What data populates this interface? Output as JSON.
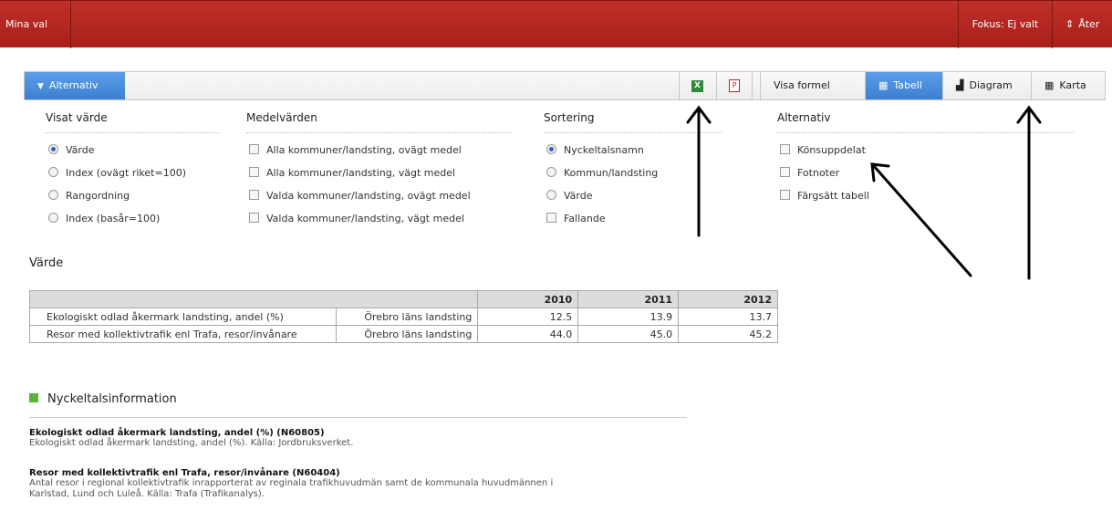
{
  "topbar": {
    "left_label": "Mina val",
    "focus_label": "Fokus: Ej valt",
    "back_label": "Åter"
  },
  "toolbar": {
    "alternativ_label": "Alternativ",
    "tabs": [
      "Visa formel",
      "Tabell",
      "Diagram",
      "Karta"
    ],
    "active_tab": "Tabell"
  },
  "options": {
    "visat_varde": {
      "title": "Visat värde",
      "items": [
        "Värde",
        "Index (ovägt riket=100)",
        "Rangordning",
        "Index (basår=100)"
      ],
      "selected": "Värde"
    },
    "medelvarden": {
      "title": "Medelvärden",
      "items": [
        "Alla kommuner/landsting, ovägt medel",
        "Alla kommuner/landsting, vägt medel",
        "Valda kommuner/landsting, ovägt medel",
        "Valda kommuner/landsting, vägt medel"
      ]
    },
    "sortering": {
      "title": "Sortering",
      "radio_items": [
        "Nyckeltalsnamn",
        "Kommun/landsting",
        "Värde"
      ],
      "selected": "Nyckeltalsnamn",
      "check_item": "Fallande"
    },
    "alternativ": {
      "title": "Alternativ",
      "items": [
        "Könsuppdelat",
        "Fotnoter",
        "Färgsätt tabell"
      ]
    }
  },
  "section_title": "Värde",
  "table": {
    "years": [
      "2010",
      "2011",
      "2012"
    ],
    "rows": [
      {
        "name": "Ekologiskt odlad åkermark landsting, andel (%)",
        "region": "Örebro läns landsting",
        "values": [
          "12.5",
          "13.9",
          "13.7"
        ]
      },
      {
        "name": "Resor med kollektivtrafik enl Trafa, resor/invånare",
        "region": "Örebro läns landsting",
        "values": [
          "44.0",
          "45.0",
          "45.2"
        ]
      }
    ]
  },
  "info": {
    "title": "Nyckeltalsinformation",
    "items": [
      {
        "title": "Ekologiskt odlad åkermark landsting, andel (%) (N60805)",
        "desc1": "Ekologiskt odlad åkermark landsting, andel (%). Källa: Jordbruksverket.",
        "desc2": ""
      },
      {
        "title": "Resor med kollektivtrafik enl Trafa, resor/invånare (N60404)",
        "desc1": "Antal resor i regional kollektivtrafik inrapporterat av reginala trafikhuvudmän samt de kommunala huvudmännen i",
        "desc2": "Karlstad, Lund och Luleå. Källa: Trafa (Trafikanalys)."
      }
    ]
  }
}
